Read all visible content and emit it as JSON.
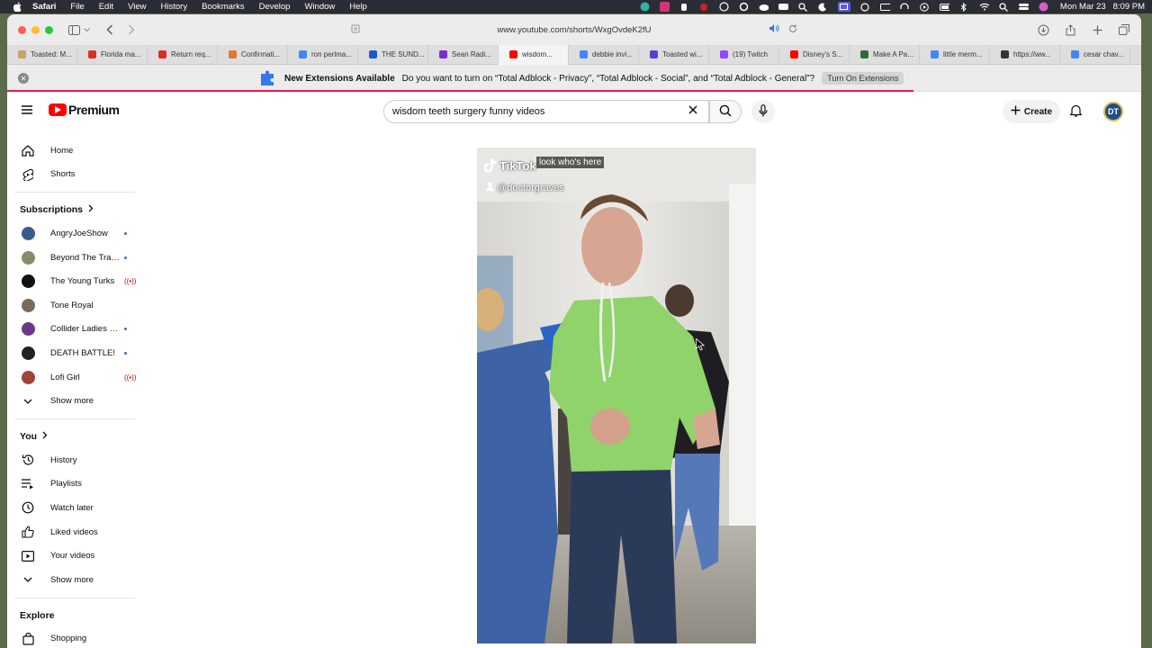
{
  "menubar": {
    "app": "Safari",
    "items": [
      "File",
      "Edit",
      "View",
      "History",
      "Bookmarks",
      "Develop",
      "Window",
      "Help"
    ],
    "date": "Mon Mar 23",
    "time": "8:09 PM"
  },
  "browser": {
    "url": "www.youtube.com/shorts/WxgOvdeK2fU",
    "tabs": [
      {
        "label": "Toasted: M...",
        "color": "#c7a26b"
      },
      {
        "label": "Florida ma...",
        "color": "#d93025"
      },
      {
        "label": "Return req...",
        "color": "#d93025"
      },
      {
        "label": "Confirmati...",
        "color": "#e07a2e"
      },
      {
        "label": "ron perlma...",
        "color": "#4285f4"
      },
      {
        "label": "THE SUND...",
        "color": "#1a56db"
      },
      {
        "label": "Sean Radi...",
        "color": "#7b2fd0"
      },
      {
        "label": "wisdom...",
        "color": "#ff0000",
        "active": true
      },
      {
        "label": "debbie invi...",
        "color": "#4285f4"
      },
      {
        "label": "Toasted wi...",
        "color": "#5b3fd0"
      },
      {
        "label": "(19) Twitch",
        "color": "#9146ff"
      },
      {
        "label": "Disney's S...",
        "color": "#ff0000"
      },
      {
        "label": "Make A Pa...",
        "color": "#2f6b3a"
      },
      {
        "label": "little merm...",
        "color": "#4285f4"
      },
      {
        "label": "https://ww...",
        "color": "#333333"
      },
      {
        "label": "cesar chav...",
        "color": "#4285f4"
      }
    ]
  },
  "extension_banner": {
    "title": "New Extensions Available",
    "message": "Do you want to turn on “Total Adblock - Privacy”, “Total Adblock - Social”, and “Total Adblock - General”?",
    "button": "Turn On Extensions"
  },
  "youtube": {
    "logo_text": "Premium",
    "search_value": "wisdom teeth surgery funny videos",
    "create_label": "Create",
    "avatar_initials": "DT"
  },
  "sidebar": {
    "main": [
      {
        "label": "Home",
        "icon": "home-icon"
      },
      {
        "label": "Shorts",
        "icon": "shorts-icon"
      }
    ],
    "subscriptions_title": "Subscriptions",
    "subscriptions": [
      {
        "label": "AngryJoeShow",
        "badge": "dot",
        "color": "#3b5b8c"
      },
      {
        "label": "Beyond The Trailer",
        "badge": "dot",
        "color": "#8a8a6a"
      },
      {
        "label": "The Young Turks",
        "badge": "live",
        "color": "#111111"
      },
      {
        "label": "Tone Royal",
        "badge": "none",
        "color": "#7a6a5a"
      },
      {
        "label": "Collider Ladies N...",
        "badge": "dot",
        "color": "#6a3a8a"
      },
      {
        "label": "DEATH BATTLE!",
        "badge": "dot",
        "color": "#222222"
      },
      {
        "label": "Lofi Girl",
        "badge": "live",
        "color": "#a0433a"
      }
    ],
    "show_more_1": "Show more",
    "you_title": "You",
    "you": [
      {
        "label": "History",
        "icon": "history-icon"
      },
      {
        "label": "Playlists",
        "icon": "playlists-icon"
      },
      {
        "label": "Watch later",
        "icon": "clock-icon"
      },
      {
        "label": "Liked videos",
        "icon": "thumbs-up-icon"
      },
      {
        "label": "Your videos",
        "icon": "video-icon"
      }
    ],
    "show_more_2": "Show more",
    "explore_title": "Explore",
    "explore": [
      {
        "label": "Shopping",
        "icon": "shopping-bag-icon"
      }
    ]
  },
  "video": {
    "watermark": "TikTok",
    "username": "@doctorgraves",
    "caption": "look who's here"
  }
}
